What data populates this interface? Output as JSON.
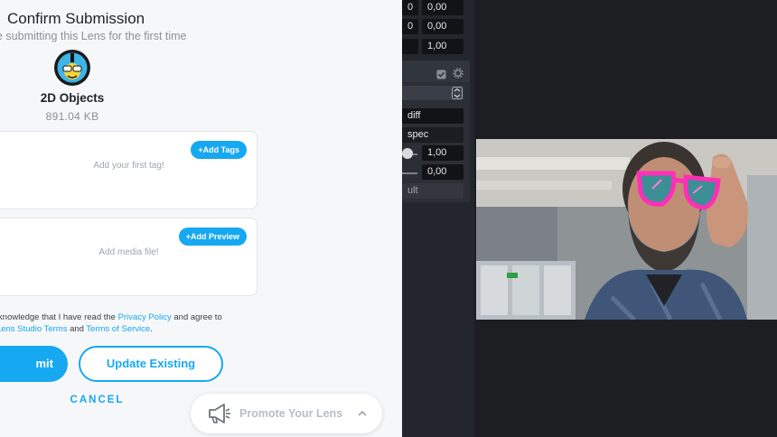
{
  "modal": {
    "title": "Confirm Submission",
    "subtitle": "e submitting this Lens for the first time",
    "lens_name": "2D Objects",
    "lens_size": "891.04 KB",
    "tags": {
      "button": "+Add Tags",
      "placeholder": "Add your first tag!"
    },
    "media": {
      "button": "+Add Preview",
      "placeholder": "Add media file!"
    },
    "legal": {
      "prefix": "acknowledge that I have read the ",
      "privacy_link": "Privacy Policy",
      "middle": " and agree to",
      "line2_prefix": "e ",
      "terms_link": "Lens Studio Terms",
      "and": " and ",
      "tos_link": "Terms of Service",
      "suffix": "."
    },
    "submit_label": "mit",
    "update_label": "Update Existing",
    "cancel_label": "CANCEL",
    "promote_label": "Promote Your Lens"
  },
  "inspector": {
    "row1_left": "0",
    "row1_value": "0,00",
    "row2_left": "0",
    "row2_value": "0,00",
    "row3_value": "1,00",
    "diff_label": "diff",
    "spec_label": "spec",
    "slider1_value": "1,00",
    "slider2_value": "0,00",
    "default_label": "ult"
  },
  "colors": {
    "accent": "#16a8f0",
    "glasses": "#ff2fb8"
  }
}
